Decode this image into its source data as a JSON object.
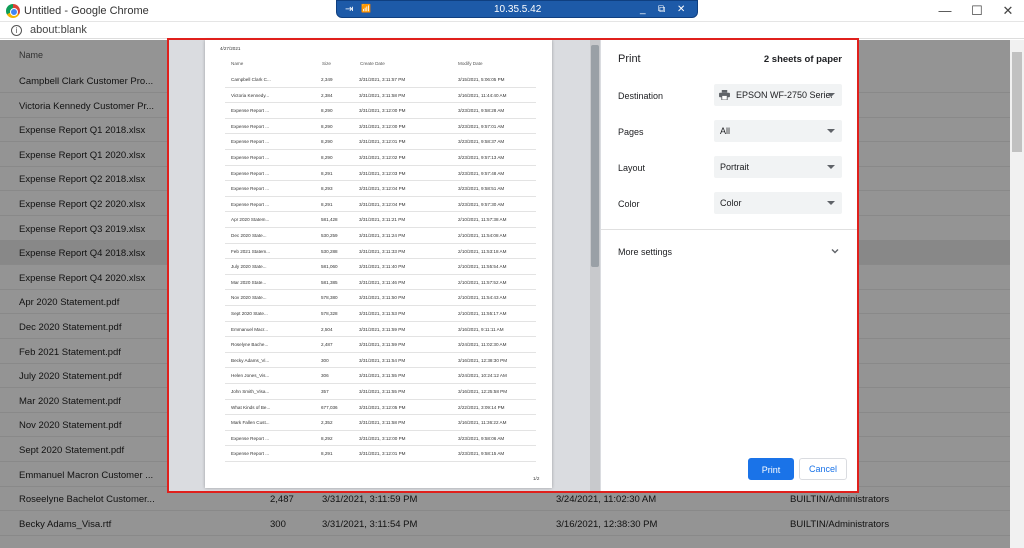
{
  "window": {
    "title": "Untitled - Google Chrome",
    "minimize": "—",
    "maximize": "☐",
    "close": "✕"
  },
  "remote_bar": {
    "clock": "10.35.5.42",
    "pin": "⇥",
    "signal": "📶",
    "min": "_",
    "restore": "⧉",
    "close": "✕"
  },
  "address": {
    "url": "about:blank",
    "info_icon": "i"
  },
  "background_list": {
    "header_name": "Name",
    "rows": [
      {
        "name": "Campbell Clark Customer Pro...",
        "size": "",
        "created": "",
        "modified": "",
        "owner": "rators"
      },
      {
        "name": "Victoria Kennedy Customer Pr...",
        "size": "",
        "created": "",
        "modified": "",
        "owner": "rators"
      },
      {
        "name": "Expense Report Q1 2018.xlsx",
        "size": "",
        "created": "",
        "modified": "",
        "owner": "rators"
      },
      {
        "name": "Expense Report Q1 2020.xlsx",
        "size": "",
        "created": "",
        "modified": "",
        "owner": "rators"
      },
      {
        "name": "Expense Report Q2 2018.xlsx",
        "size": "",
        "created": "",
        "modified": "",
        "owner": "rators"
      },
      {
        "name": "Expense Report Q2 2020.xlsx",
        "size": "",
        "created": "",
        "modified": "",
        "owner": "rators"
      },
      {
        "name": "Expense Report Q3 2019.xlsx",
        "size": "",
        "created": "",
        "modified": "",
        "owner": "rators"
      },
      {
        "name": "Expense Report Q4 2018.xlsx",
        "size": "",
        "created": "",
        "modified": "",
        "owner": "rators"
      },
      {
        "name": "Expense Report Q4 2020.xlsx",
        "size": "",
        "created": "",
        "modified": "",
        "owner": "rators"
      },
      {
        "name": "Apr 2020 Statement.pdf",
        "size": "",
        "created": "",
        "modified": "",
        "owner": "rators"
      },
      {
        "name": "Dec 2020 Statement.pdf",
        "size": "",
        "created": "",
        "modified": "",
        "owner": "rators"
      },
      {
        "name": "Feb 2021 Statement.pdf",
        "size": "",
        "created": "",
        "modified": "",
        "owner": "rators"
      },
      {
        "name": "July 2020 Statement.pdf",
        "size": "",
        "created": "",
        "modified": "",
        "owner": "rators"
      },
      {
        "name": "Mar 2020 Statement.pdf",
        "size": "",
        "created": "",
        "modified": "",
        "owner": "rators"
      },
      {
        "name": "Nov 2020 Statement.pdf",
        "size": "",
        "created": "",
        "modified": "",
        "owner": "rators"
      },
      {
        "name": "Sept 2020 Statement.pdf",
        "size": "",
        "created": "",
        "modified": "",
        "owner": "rators"
      },
      {
        "name": "Emmanuel Macron Customer ...",
        "size": "",
        "created": "",
        "modified": "",
        "owner": "rators"
      },
      {
        "name": "Roseelyne Bachelot Customer...",
        "size": "2,487",
        "created": "3/31/2021, 3:11:59 PM",
        "modified": "3/24/2021, 11:02:30 AM",
        "owner": "BUILTIN/Administrators"
      },
      {
        "name": "Becky Adams_Visa.rtf",
        "size": "300",
        "created": "3/31/2021, 3:11:54 PM",
        "modified": "3/16/2021, 12:38:30 PM",
        "owner": "BUILTIN/Administrators"
      }
    ]
  },
  "preview": {
    "date": "4/27/2021",
    "columns": [
      "Name",
      "Size",
      "Create Date",
      "Modify Date"
    ],
    "rows": [
      [
        "Campbell Clark C...",
        "2,349",
        "3/31/2021, 3:11:57 PM",
        "3/15/2021, 5:06:05 PM"
      ],
      [
        "Victoria Kennedy...",
        "2,384",
        "3/31/2021, 3:11:58 PM",
        "3/16/2021, 11:44:40 AM"
      ],
      [
        "Expense Report ...",
        "8,290",
        "3/31/2021, 3:12:00 PM",
        "3/23/2021, 9:58:28 AM"
      ],
      [
        "Expense Report ...",
        "8,290",
        "3/31/2021, 3:12:00 PM",
        "3/23/2021, 9:57:01 AM"
      ],
      [
        "Expense Report ...",
        "8,290",
        "3/31/2021, 3:12:01 PM",
        "3/23/2021, 9:58:37 AM"
      ],
      [
        "Expense Report ...",
        "8,290",
        "3/31/2021, 3:12:02 PM",
        "3/23/2021, 9:57:13 AM"
      ],
      [
        "Expense Report ...",
        "8,291",
        "3/31/2021, 3:12:03 PM",
        "3/23/2021, 9:57:48 AM"
      ],
      [
        "Expense Report ...",
        "8,293",
        "3/31/2021, 3:12:04 PM",
        "3/23/2021, 9:58:51 AM"
      ],
      [
        "Expense Report ...",
        "8,291",
        "3/31/2021, 3:12:04 PM",
        "3/23/2021, 9:57:30 AM"
      ],
      [
        "Apr 2020 Statem...",
        "581,428",
        "3/31/2021, 3:11:21 PM",
        "2/10/2021, 11:57:38 AM"
      ],
      [
        "Dec 2020 State...",
        "530,259",
        "3/31/2021, 3:11:24 PM",
        "2/10/2021, 11:54:08 AM"
      ],
      [
        "Feb 2021 Statem...",
        "530,288",
        "3/31/2021, 3:11:33 PM",
        "2/10/2021, 11:53:18 AM"
      ],
      [
        "July 2020 State...",
        "581,060",
        "3/31/2021, 3:11:40 PM",
        "2/10/2021, 11:55:54 AM"
      ],
      [
        "Mar 2020 State...",
        "581,385",
        "3/31/2021, 3:11:46 PM",
        "2/10/2021, 11:57:52 AM"
      ],
      [
        "Nov 2020 State...",
        "578,380",
        "3/31/2021, 3:11:50 PM",
        "2/10/2021, 11:54:43 AM"
      ],
      [
        "Sept 2020 State...",
        "578,328",
        "3/31/2021, 3:11:53 PM",
        "2/10/2021, 11:55:17 AM"
      ],
      [
        "Emmanuel Macr...",
        "2,504",
        "3/31/2021, 3:11:59 PM",
        "3/16/2021, 9:11:11 AM"
      ],
      [
        "Roselyne Bache...",
        "2,487",
        "3/31/2021, 3:11:59 PM",
        "3/24/2021, 11:02:30 AM"
      ],
      [
        "Becky Adams_Vi...",
        "300",
        "3/31/2021, 3:11:54 PM",
        "3/16/2021, 12:38:30 PM"
      ],
      [
        "Helen Jones_Vis...",
        "306",
        "3/31/2021, 3:11:55 PM",
        "3/24/2021, 10:24:12 AM"
      ],
      [
        "John Smith_Visa...",
        "357",
        "3/31/2021, 3:11:55 PM",
        "3/16/2021, 12:25:58 PM"
      ],
      [
        "What Kinds of Be...",
        "677,036",
        "3/31/2021, 3:12:05 PM",
        "2/22/2021, 3:09:14 PM"
      ],
      [
        "Mark Fallen Cust...",
        "2,352",
        "3/31/2021, 3:11:58 PM",
        "3/16/2021, 11:36:22 AM"
      ],
      [
        "Expense Report ...",
        "8,292",
        "3/31/2021, 3:12:00 PM",
        "3/23/2021, 9:58:06 AM"
      ],
      [
        "Expense Report ...",
        "8,291",
        "3/31/2021, 3:12:01 PM",
        "3/23/2021, 9:58:15 AM"
      ]
    ],
    "page_number": "1/2"
  },
  "print_panel": {
    "title": "Print",
    "sheets": "2 sheets of paper",
    "destination_label": "Destination",
    "destination_value": "EPSON WF-2750 Series",
    "pages_label": "Pages",
    "pages_value": "All",
    "layout_label": "Layout",
    "layout_value": "Portrait",
    "color_label": "Color",
    "color_value": "Color",
    "more_settings": "More settings",
    "print_button": "Print",
    "cancel_button": "Cancel"
  },
  "colors": {
    "accent": "#1a73e8",
    "frame": "#e0201c"
  }
}
